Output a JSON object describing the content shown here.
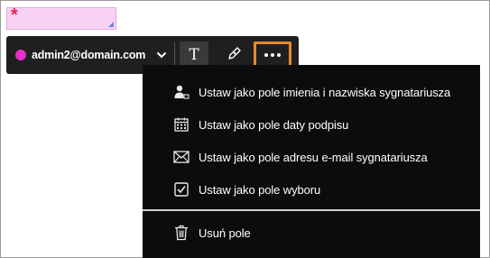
{
  "field": {
    "required_marker": "*"
  },
  "toolbar": {
    "recipient_email": "admin2@domain.com",
    "recipient_color": "#e62fc4",
    "text_tool_label": "T",
    "more_highlight_color": "#e9892b"
  },
  "menu": {
    "items": [
      {
        "icon": "person-name-icon",
        "label": "Ustaw jako pole imienia i nazwiska sygnatariusza"
      },
      {
        "icon": "calendar-icon",
        "label": "Ustaw jako pole daty podpisu"
      },
      {
        "icon": "envelope-icon",
        "label": "Ustaw jako pole adresu e-mail sygnatariusza"
      },
      {
        "icon": "checkbox-icon",
        "label": "Ustaw jako pole wyboru"
      }
    ],
    "delete": {
      "icon": "trash-icon",
      "label": "Usuń pole"
    }
  }
}
